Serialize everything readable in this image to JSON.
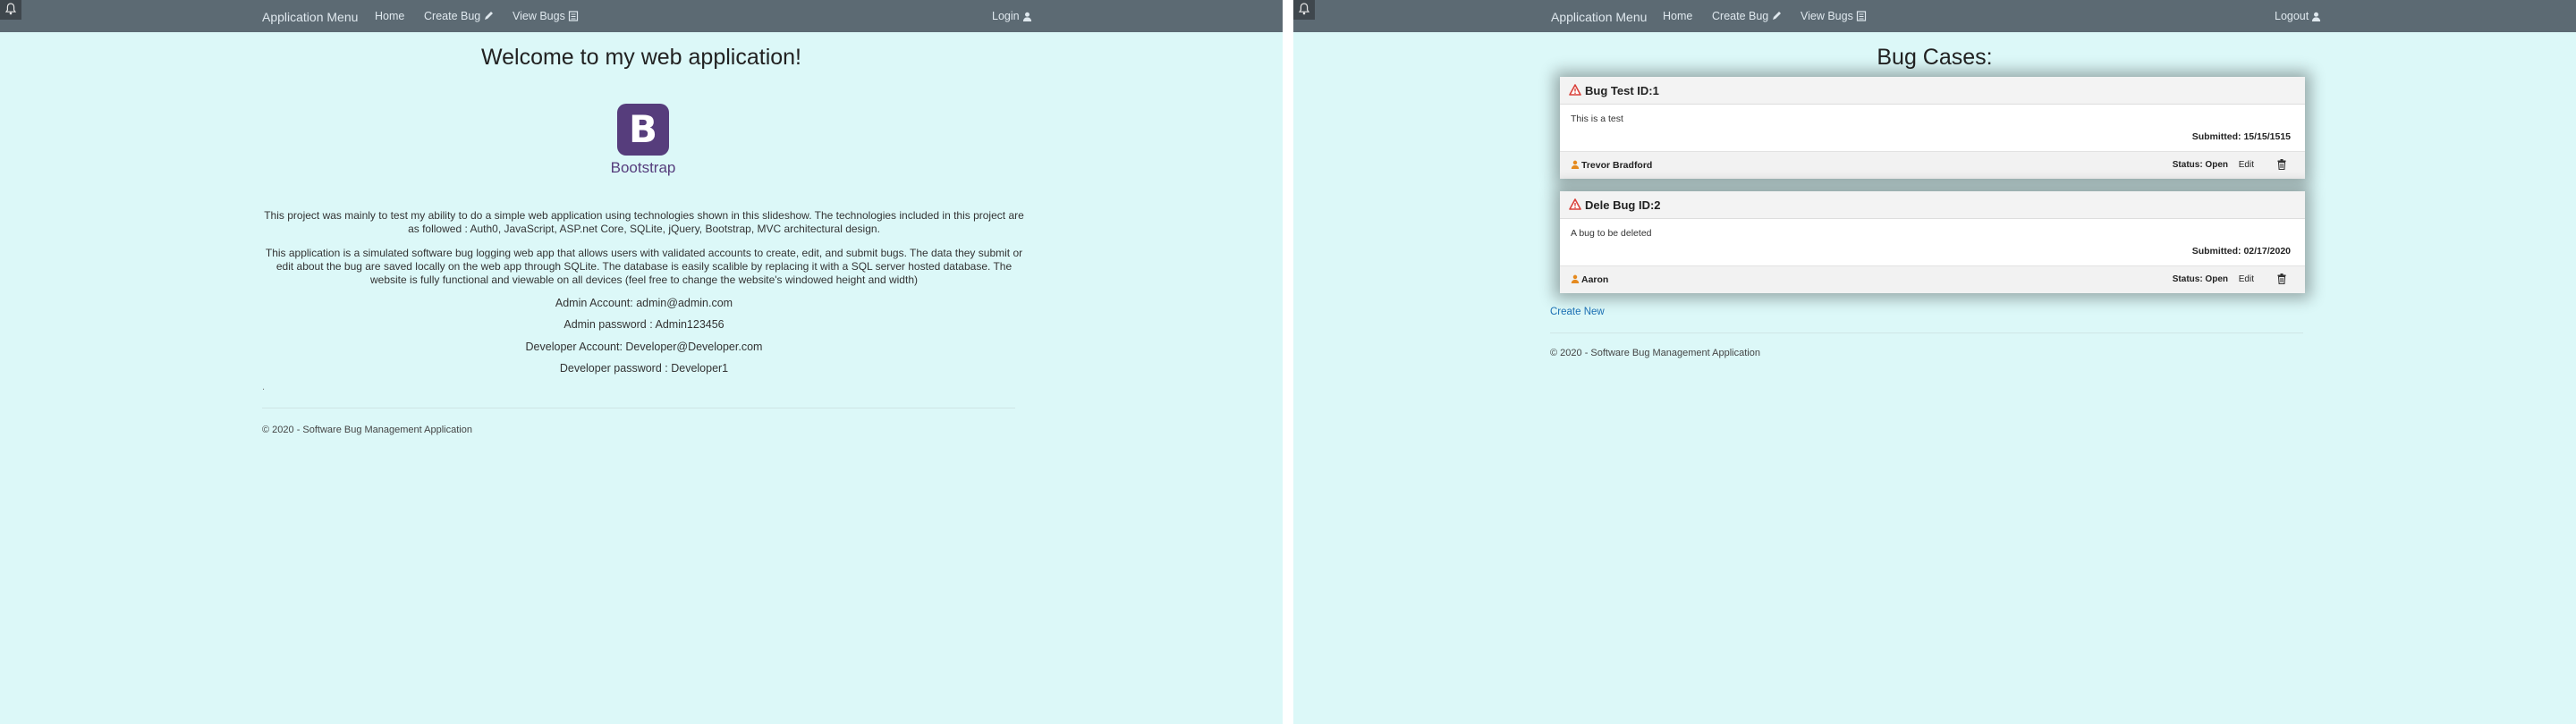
{
  "nav": {
    "brand": "Application Menu",
    "home": "Home",
    "create_bug": "Create Bug",
    "view_bugs": "View Bugs",
    "login": "Login",
    "logout": "Logout"
  },
  "home_page": {
    "title": "Welcome to my web application!",
    "logo_letter": "B",
    "logo_text": "Bootstrap",
    "paragraph1": "This project was mainly to test my ability to do a simple web application using technologies shown in this slideshow. The technologies included in this project are as followed : Auth0, JavaScript, ASP.net Core, SQLite, jQuery, Bootstrap, MVC architectural design.",
    "paragraph2": "This application is a simulated software bug logging web app that allows users with validated accounts to create, edit, and submit bugs. The data they submit or edit about the bug are saved locally on the web app through SQLite. The database is easily scalible by replacing it with a SQL server hosted database. The website is fully functional and viewable on all devices (feel free to change the website's windowed height and width)",
    "credentials": [
      "Admin Account: admin@admin.com",
      "Admin password : Admin123456",
      "Developer Account: Developer@Developer.com",
      "Developer password : Developer1"
    ],
    "dot": ".",
    "footer": "© 2020 - Software Bug Management Application"
  },
  "bugs_page": {
    "title": "Bug Cases:",
    "bugs": [
      {
        "title": "Bug Test ID:1",
        "description": "This is a test",
        "submitted": "Submitted: 15/15/1515",
        "user": "Trevor Bradford",
        "status": "Status: Open",
        "edit": "Edit"
      },
      {
        "title": "Dele Bug ID:2",
        "description": "A bug to be deleted",
        "submitted": "Submitted: 02/17/2020",
        "user": "Aaron",
        "status": "Status: Open",
        "edit": "Edit"
      }
    ],
    "create_new": "Create New",
    "footer": "© 2020 - Software Bug Management Application"
  },
  "colors": {
    "background": "#dcf8f8",
    "navbar": "#5c6a73",
    "bootstrap_purple": "#563d7c",
    "warning_red": "#d9413a",
    "user_orange": "#e58a1f",
    "link_blue": "#1b6fb3"
  },
  "icons": {
    "corner": "bell-icon",
    "create_bug": "pencil-icon",
    "view_bugs": "list-icon",
    "auth": "user-icon",
    "bug": "warning-icon",
    "reporter": "user-icon",
    "delete": "trash-icon"
  }
}
